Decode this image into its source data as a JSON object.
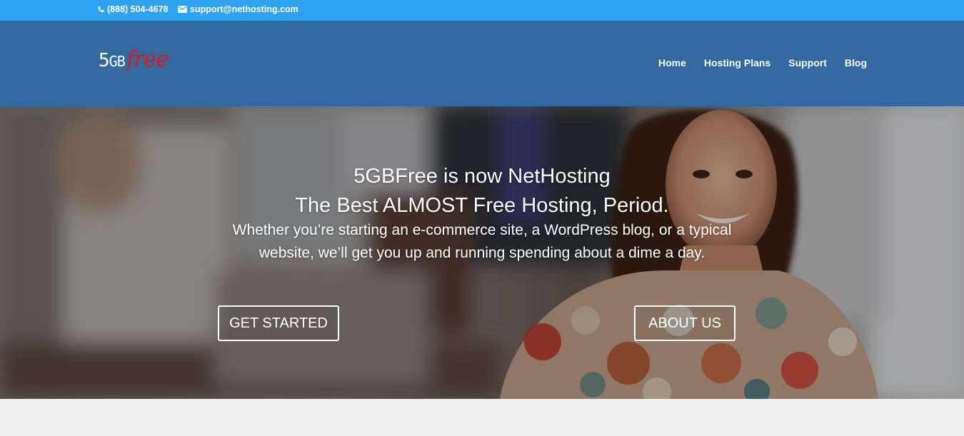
{
  "topbar": {
    "phone": "(888) 504-4678",
    "email": "support@nethosting.com",
    "background": "#2ea3f2"
  },
  "header": {
    "logo": {
      "number": "5",
      "gb": "GB",
      "word": "free"
    },
    "background": "#33699f",
    "nav": [
      "Home",
      "Hosting Plans",
      "Support",
      "Blog"
    ]
  },
  "hero": {
    "title_line1": "5GBFree is now NetHosting",
    "title_line2": "The Best ALMOST Free Hosting, Period.",
    "subtitle_line1": "Whether you’re starting an e-commerce site, a WordPress blog, or a typical",
    "subtitle_line2": "website, we’ll get you up and running spending about a dime a day.",
    "button_start": "GET STARTED",
    "button_about": "ABOUT US"
  }
}
